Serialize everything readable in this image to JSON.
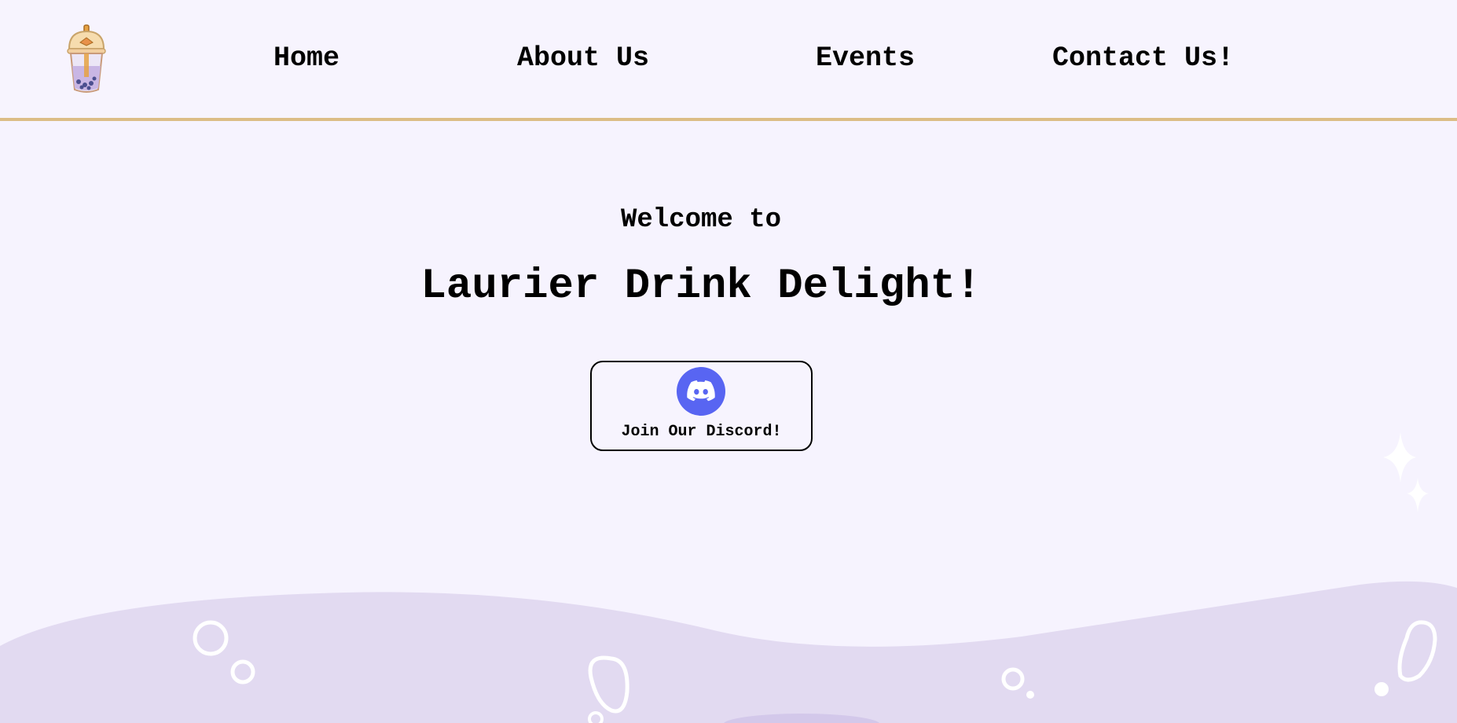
{
  "page": {
    "background": "#f6f3fe",
    "accent": "#dcbd86",
    "wave_color": "#e2daf1"
  },
  "navbar": {
    "logo_icon": "bubble-tea-cup-icon",
    "links": [
      {
        "label": "Home"
      },
      {
        "label": "About Us"
      },
      {
        "label": "Events"
      },
      {
        "label": "Contact Us!"
      }
    ]
  },
  "hero": {
    "subtitle": "Welcome to",
    "title": "Laurier Drink Delight!"
  },
  "discord": {
    "icon": "discord-icon",
    "icon_color": "#5865f2",
    "label": "Join Our Discord!"
  },
  "decor": {
    "sparkle_icon": "sparkle-icon",
    "bubble_icon": "bubble-outline-icon"
  }
}
